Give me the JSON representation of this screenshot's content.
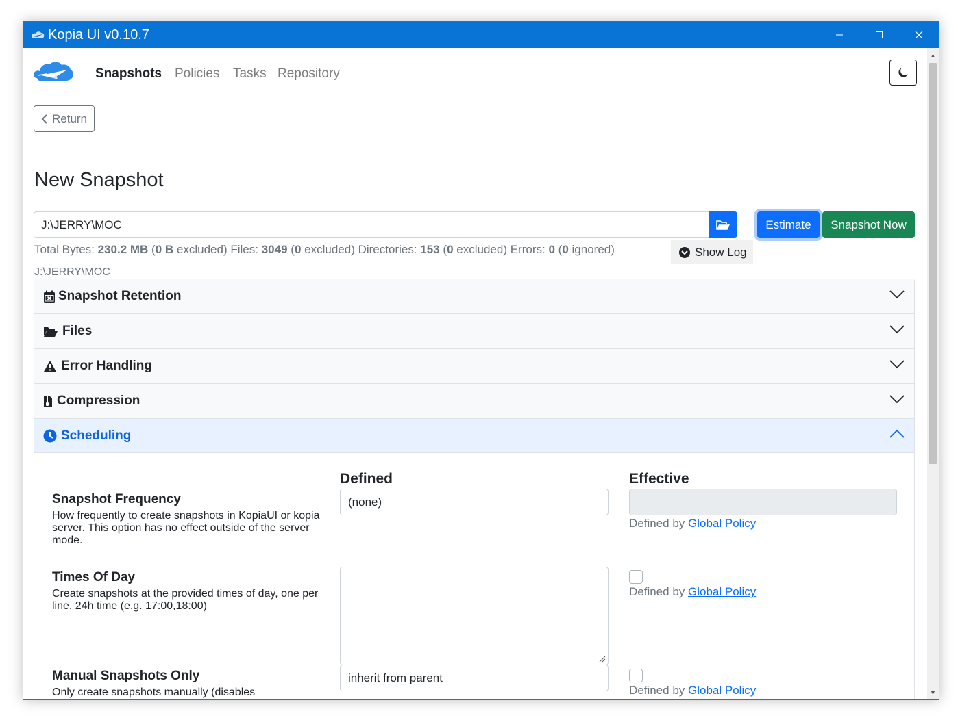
{
  "window": {
    "title": "Kopia UI v0.10.7"
  },
  "nav": {
    "items": [
      {
        "label": "Snapshots"
      },
      {
        "label": "Policies"
      },
      {
        "label": "Tasks"
      },
      {
        "label": "Repository"
      }
    ]
  },
  "page": {
    "return_label": "Return",
    "title": "New Snapshot",
    "path_value": "J:\\JERRY\\MOC",
    "estimate_label": "Estimate",
    "snapshot_now_label": "Snapshot Now",
    "show_log_label": "Show Log",
    "path_label": "J:\\JERRY\\MOC"
  },
  "stats": {
    "total_bytes_label": "Total Bytes:",
    "total_bytes": "230.2 MB",
    "bytes_excluded": "0 B",
    "files_label": "Files:",
    "files": "3049",
    "files_excluded": "0",
    "dirs_label": "Directories:",
    "dirs": "153",
    "dirs_excluded": "0",
    "errors_label": "Errors:",
    "errors": "0",
    "errors_ignored": "0",
    "excluded_word": "excluded",
    "ignored_word": "ignored"
  },
  "accordion": {
    "sections": [
      {
        "title": "Snapshot Retention",
        "icon": "calendar-x-icon"
      },
      {
        "title": "Files",
        "icon": "folder-open-icon"
      },
      {
        "title": "Error Handling",
        "icon": "warning-icon"
      },
      {
        "title": "Compression",
        "icon": "file-zip-icon"
      },
      {
        "title": "Scheduling",
        "icon": "clock-icon"
      }
    ]
  },
  "scheduling": {
    "defined_header": "Defined",
    "effective_header": "Effective",
    "defined_by_text": "Defined by",
    "global_policy_link": "Global Policy",
    "options": [
      {
        "title": "Snapshot Frequency",
        "description": "How frequently to create snapshots in KopiaUI or kopia server. This option has no effect outside of the server mode.",
        "value": "(none)"
      },
      {
        "title": "Times Of Day",
        "description": "Create snapshots at the provided times of day, one per line, 24h time (e.g. 17:00,18:00)",
        "value": ""
      },
      {
        "title": "Manual Snapshots Only",
        "description": "Only create snapshots manually (disables scheduled snapshots).",
        "value": "inherit from parent"
      }
    ]
  },
  "colors": {
    "titlebar": "#0a73d6",
    "primary": "#0d6efd",
    "success": "#198754"
  }
}
